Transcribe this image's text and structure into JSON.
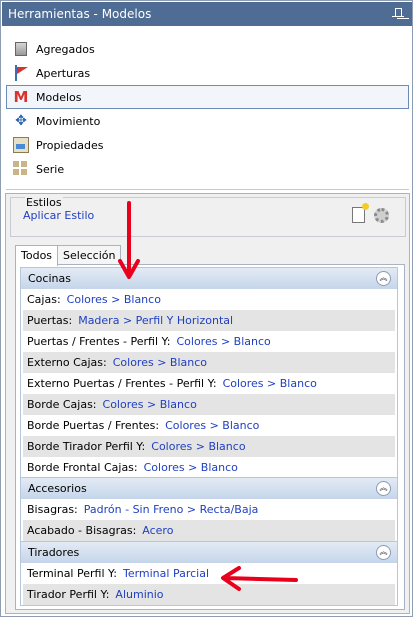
{
  "window": {
    "title": "Herramientas - Modelos"
  },
  "nav": {
    "items": [
      {
        "label": "Agregados",
        "icon": "agregados-icon",
        "selected": false
      },
      {
        "label": "Aperturas",
        "icon": "aperturas-icon",
        "selected": false
      },
      {
        "label": "Modelos",
        "icon": "modelos-icon",
        "selected": true
      },
      {
        "label": "Movimiento",
        "icon": "movimiento-icon",
        "selected": false
      },
      {
        "label": "Propiedades",
        "icon": "propiedades-icon",
        "selected": false
      },
      {
        "label": "Serie",
        "icon": "serie-icon",
        "selected": false
      }
    ]
  },
  "estilos": {
    "label": "Estilos",
    "apply_link": "Aplicar Estilo"
  },
  "tabs": [
    {
      "label": "Todos",
      "active": true
    },
    {
      "label": "Selección",
      "active": false
    }
  ],
  "groups": [
    {
      "title": "Cocinas",
      "rows": [
        {
          "label": "Cajas:",
          "value": "Colores > Blanco"
        },
        {
          "label": "Puertas:",
          "value": "Madera > Perfil Y Horizontal"
        },
        {
          "label": "Puertas / Frentes - Perfil Y:",
          "value": "Colores > Blanco"
        },
        {
          "label": "Externo Cajas:",
          "value": "Colores > Blanco"
        },
        {
          "label": "Externo Puertas / Frentes - Perfil Y:",
          "value": "Colores > Blanco"
        },
        {
          "label": "Borde Cajas:",
          "value": "Colores > Blanco"
        },
        {
          "label": "Borde Puertas / Frentes:",
          "value": "Colores > Blanco"
        },
        {
          "label": "Borde Tirador Perfil Y:",
          "value": "Colores > Blanco"
        },
        {
          "label": "Borde Frontal Cajas:",
          "value": "Colores > Blanco"
        }
      ]
    },
    {
      "title": "Accesorios",
      "rows": [
        {
          "label": "Bisagras:",
          "value": "Padrón - Sin Freno > Recta/Baja"
        },
        {
          "label": "Acabado - Bisagras:",
          "value": "Acero"
        }
      ]
    },
    {
      "title": "Tiradores",
      "rows": [
        {
          "label": "Terminal Perfil Y:",
          "value": "Terminal Parcial"
        },
        {
          "label": "Tirador Perfil Y:",
          "value": "Aluminio"
        }
      ]
    }
  ],
  "colors": {
    "titlebar": "#4f6c94",
    "link": "#1f3fc0",
    "group_header": "#c5d5ea",
    "annotation_arrow": "#e8001c"
  }
}
